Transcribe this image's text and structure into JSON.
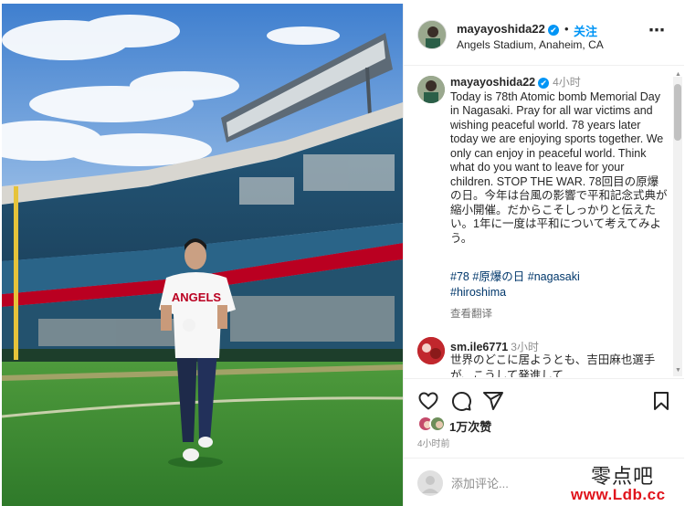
{
  "header": {
    "username": "mayayoshida22",
    "verified_mark": "✔",
    "separator": "•",
    "follow_label": "关注",
    "location": "Angels Stadium, Anaheim, CA",
    "more_icon": "⋯"
  },
  "post": {
    "username": "mayayoshida22",
    "time": "4小时",
    "caption": "Today is 78th Atomic bomb Memorial Day in Nagasaki. Pray for all war victims and wishing peaceful world. 78 years later today we are enjoying sports together. We only can enjoy in peaceful world. Think what do you want to leave for your children. STOP THE WAR. 78回目の原爆の日。今年は台風の影響で平和記念式典が縮小開催。だからこそしっかりと伝えたい。1年に一度は平和について考えてみよう。",
    "hashtags": [
      "#78",
      "#原爆の日",
      "#nagasaki",
      "#hiroshima"
    ],
    "translate_label": "查看翻译"
  },
  "comment": {
    "username": "sm.ile6771",
    "time": "3小时",
    "text": "世界のどこに居ようとも、吉田麻也選手が、こうして発進して"
  },
  "likes": {
    "count_label": "1万次赞",
    "time_ago": "4小时前"
  },
  "add_comment": {
    "placeholder": "添加评论..."
  },
  "photo": {
    "jersey_text": "ANGELS"
  },
  "watermark": {
    "line1": "零点吧",
    "line2": "www.Ldb.cc"
  },
  "colors": {
    "link_blue": "#0095f6",
    "hashtag": "#00376b",
    "sky": "#5b93d4",
    "grass": "#3d8a33",
    "angels_red": "#ba0021"
  }
}
